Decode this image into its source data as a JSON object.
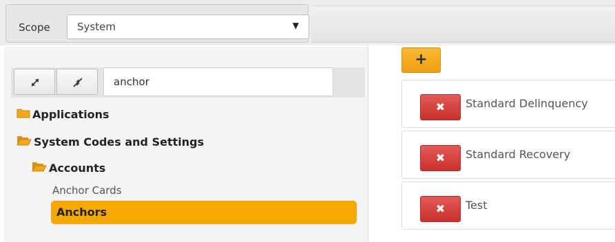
{
  "scope": {
    "label": "Scope",
    "selected": "System",
    "caret": "▼"
  },
  "tree": {
    "search_value": "anchor",
    "nodes": [
      {
        "label": "Applications"
      },
      {
        "label": "System Codes and Settings"
      },
      {
        "label": "Accounts"
      },
      {
        "label": "Anchor Cards"
      },
      {
        "label": "Anchors"
      }
    ]
  },
  "right": {
    "add_label": "+",
    "delete_label": "✖",
    "items": [
      {
        "label": "Standard Delinquency"
      },
      {
        "label": "Standard Recovery"
      },
      {
        "label": "Test"
      }
    ]
  },
  "colors": {
    "accent": "#f7a800",
    "delete": "#d9423e",
    "folder": "#f2a81d"
  }
}
